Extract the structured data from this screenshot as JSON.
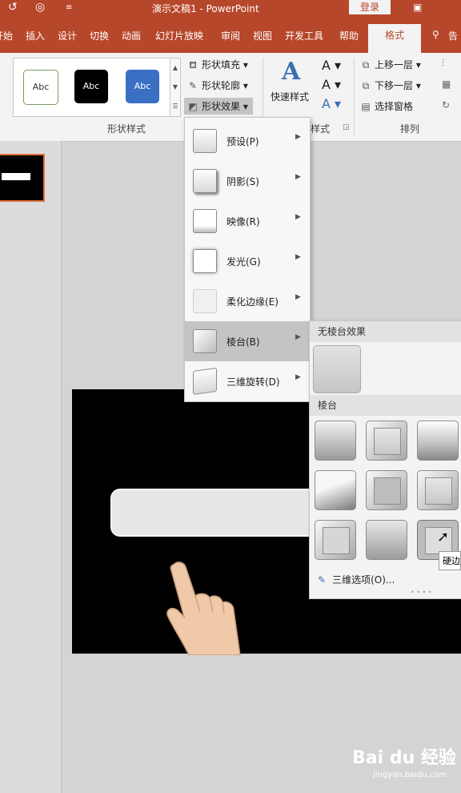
{
  "titlebar": {
    "doc_title": "演示文稿1  -  PowerPoint",
    "login": "登录",
    "icons": [
      "undo-icon",
      "present-icon",
      "qat-dropdown-icon",
      "ribbon-display-icon"
    ]
  },
  "ribbon_tabs": [
    "开始",
    "插入",
    "设计",
    "切换",
    "动画",
    "幻灯片放映",
    "审阅",
    "视图",
    "开发工具",
    "帮助",
    "格式",
    "告"
  ],
  "ribbon": {
    "style_samples": [
      "Abc",
      "Abc",
      "Abc"
    ],
    "fill": "形状填充",
    "outline": "形状轮廓",
    "effects": "形状效果",
    "shape_styles_label": "形状样式",
    "quick_styles": "快速样式",
    "art_styles_label": "样式",
    "bring_forward": "上移一层",
    "send_backward": "下移一层",
    "selection_pane": "选择窗格",
    "arrange_label": "排列"
  },
  "effects_menu": [
    {
      "label": "预设(P)"
    },
    {
      "label": "阴影(S)"
    },
    {
      "label": "映像(R)"
    },
    {
      "label": "发光(G)"
    },
    {
      "label": "柔化边缘(E)"
    },
    {
      "label": "棱台(B)"
    },
    {
      "label": "三维旋转(D)"
    }
  ],
  "bevel_panel": {
    "no_bevel": "无棱台效果",
    "bevel_heading": "棱台",
    "three_d_options": "三维选项(O)..."
  },
  "tooltip": "硬边",
  "watermark": {
    "brand": "Bai du 经验",
    "url": "jingyan.baidu.com"
  },
  "colors": {
    "accent": "#b7472a",
    "ribbon_bg": "#f3f3f3",
    "highlight": "#c4c4c4",
    "selected_thumb": "#e0703b"
  }
}
